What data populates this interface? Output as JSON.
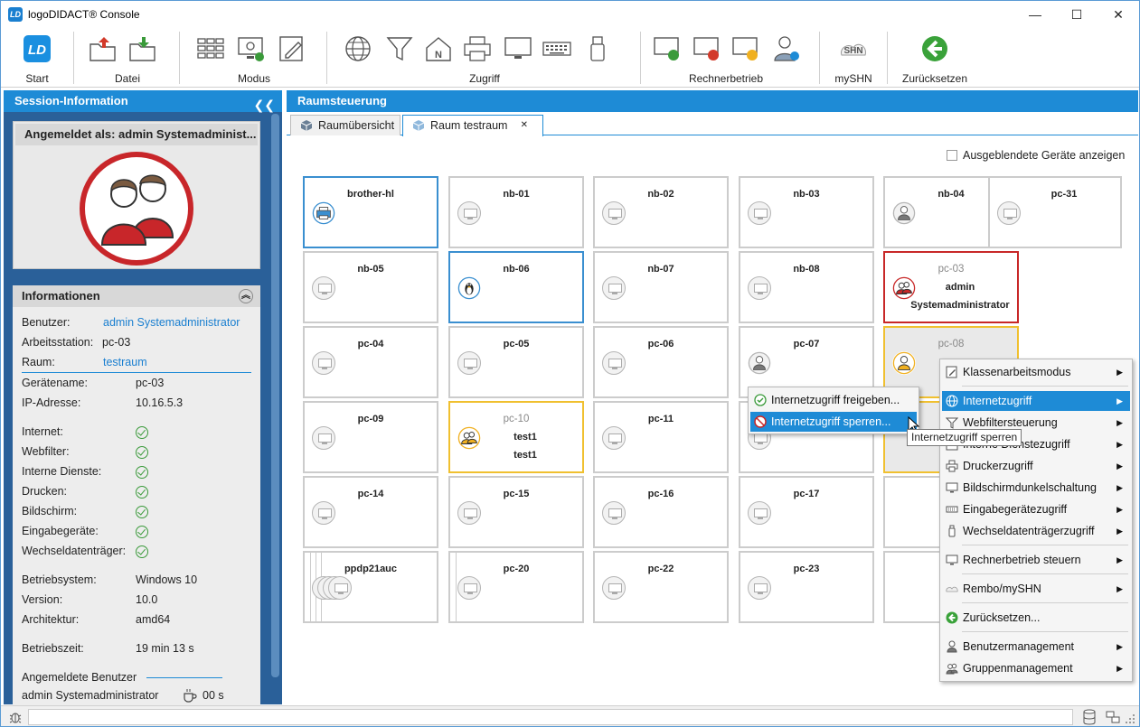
{
  "window": {
    "title": "logoDIDACT® Console",
    "logo_text": "LD",
    "minimize": "—",
    "maximize": "☐",
    "close": "✕"
  },
  "ribbon": {
    "groups": [
      {
        "label": "Start"
      },
      {
        "label": "Datei"
      },
      {
        "label": "Modus"
      },
      {
        "label": "Zugriff"
      },
      {
        "label": "Rechnerbetrieb"
      },
      {
        "label": "mySHN"
      },
      {
        "label": "Zurücksetzen"
      }
    ],
    "shn_text": "SHN"
  },
  "left_panel": {
    "title": "Session-Information",
    "session_card_title": "Angemeldet als: admin Systemadminist...",
    "info_title": "Informationen",
    "rows": {
      "benutzer_label": "Benutzer:",
      "benutzer_value": "admin Systemadministrator",
      "arbeitsstation_label": "Arbeitsstation:",
      "arbeitsstation_value": "pc-03",
      "raum_label": "Raum:",
      "raum_value": "testraum",
      "geraetename_label": "Gerätename:",
      "geraetename_value": "pc-03",
      "ip_label": "IP-Adresse:",
      "ip_value": "10.16.5.3",
      "internet_label": "Internet:",
      "webfilter_label": "Webfilter:",
      "dienste_label": "Interne Dienste:",
      "drucken_label": "Drucken:",
      "bildschirm_label": "Bildschirm:",
      "eingabe_label": "Eingabegeräte:",
      "wechsel_label": "Wechseldatenträger:",
      "os_label": "Betriebsystem:",
      "os_value": "Windows 10",
      "version_label": "Version:",
      "version_value": "10.0",
      "arch_label": "Architektur:",
      "arch_value": "amd64",
      "uptime_label": "Betriebszeit:",
      "uptime_value": "19 min 13 s",
      "users_label": "Angemeldete Benutzer",
      "user_name": "admin Systemadministrator",
      "user_idle": "00 s"
    }
  },
  "main": {
    "title": "Raumsteuerung",
    "tabs": [
      {
        "label": "Raumübersicht"
      },
      {
        "label": "Raum testraum"
      }
    ],
    "tab_close": "✕",
    "hidden_devices_label": "Ausgeblendete Geräte anzeigen",
    "devices": {
      "brother": "brother-hl",
      "nb01": "nb-01",
      "nb02": "nb-02",
      "nb03": "nb-03",
      "nb04": "nb-04",
      "pc31": "pc-31",
      "nb05": "nb-05",
      "nb06": "nb-06",
      "nb07": "nb-07",
      "nb08": "nb-08",
      "pc03": "pc-03",
      "pc03_user1": "admin",
      "pc03_user2": "Systemadministrator",
      "pc04": "pc-04",
      "pc05": "pc-05",
      "pc06": "pc-06",
      "pc07": "pc-07",
      "pc08": "pc-08",
      "pc09": "pc-09",
      "pc10": "pc-10",
      "pc10_user1": "test1",
      "pc10_user2": "test1",
      "pc11": "pc-11",
      "pc14": "pc-14",
      "pc15": "pc-15",
      "pc16": "pc-16",
      "pc17": "pc-17",
      "overlap": "ppdp21auc",
      "pc20": "pc-20",
      "pc22": "pc-22",
      "pc23": "pc-23"
    }
  },
  "context_menu": {
    "items": [
      {
        "label": "Klassenarbeitsmodus"
      },
      {
        "label": "Internetzugriff"
      },
      {
        "label": "Webfiltersteuerung"
      },
      {
        "label": "Interne Dienstezugriff"
      },
      {
        "label": "Druckerzugriff"
      },
      {
        "label": "Bildschirmdunkelschaltung"
      },
      {
        "label": "Eingabegerätezugriff"
      },
      {
        "label": "Wechseldatenträgerzugriff"
      },
      {
        "label": "Rechnerbetrieb steuern"
      },
      {
        "label": "Rembo/mySHN"
      },
      {
        "label": "Zurücksetzen..."
      },
      {
        "label": "Benutzermanagement"
      },
      {
        "label": "Gruppenmanagement"
      }
    ],
    "arrow": "▶"
  },
  "submenu": {
    "items": [
      {
        "label": "Internetzugriff freigeben..."
      },
      {
        "label": "Internetzugriff sperren..."
      }
    ]
  },
  "tooltip": {
    "text": "Internetzugriff sperren"
  },
  "colors": {
    "accent": "#1e8bd6",
    "panel": "#2a6099",
    "red": "#c82828",
    "yellow": "#f0c030",
    "green": "#3a9a3a"
  }
}
